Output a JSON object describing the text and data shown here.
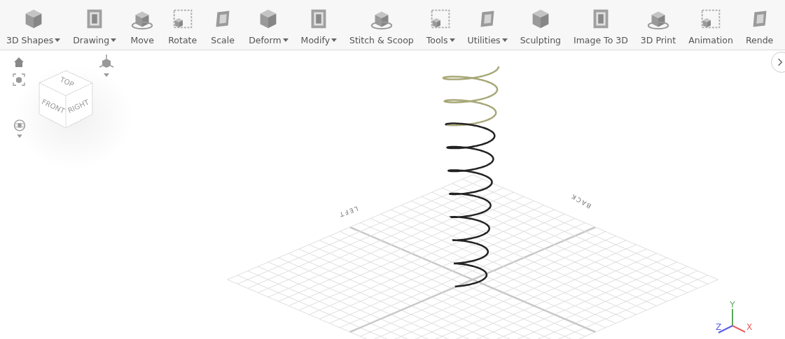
{
  "toolbar": [
    {
      "label": "3D Shapes",
      "dropdown": true
    },
    {
      "label": "Drawing",
      "dropdown": true
    },
    {
      "label": "Move",
      "dropdown": false
    },
    {
      "label": "Rotate",
      "dropdown": false
    },
    {
      "label": "Scale",
      "dropdown": false
    },
    {
      "label": "Deform",
      "dropdown": true
    },
    {
      "label": "Modify",
      "dropdown": true
    },
    {
      "label": "Stitch & Scoop",
      "dropdown": false
    },
    {
      "label": "Tools",
      "dropdown": true
    },
    {
      "label": "Utilities",
      "dropdown": true
    },
    {
      "label": "Sculpting",
      "dropdown": false
    },
    {
      "label": "Image To 3D",
      "dropdown": false
    },
    {
      "label": "3D Print",
      "dropdown": false
    },
    {
      "label": "Animation",
      "dropdown": false
    },
    {
      "label": "Rende",
      "dropdown": false
    }
  ],
  "view_cube": {
    "faces": [
      "TOP",
      "FRONT",
      "RIGHT"
    ]
  },
  "grid_labels": [
    "LEFT",
    "BACK"
  ],
  "axes": [
    "X",
    "Y",
    "Z"
  ]
}
